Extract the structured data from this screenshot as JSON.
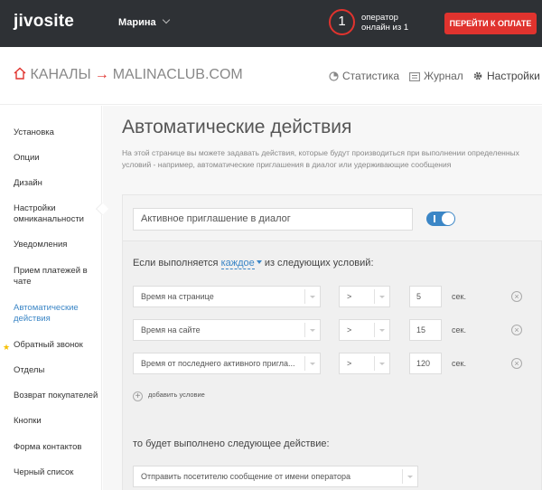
{
  "topbar": {
    "logo": "jivosite",
    "user_name": "Марина",
    "operators_count": "1",
    "operators_text_1": "оператор",
    "operators_text_2": "онлайн из 1",
    "pay_button": "ПЕРЕЙТИ К ОПЛАТЕ",
    "accent_color": "#e0332e"
  },
  "breadcrumb": {
    "root": "КАНАЛЫ",
    "arrow": "→",
    "current": "MALINACLUB.COM"
  },
  "nav": {
    "stats": "Статистика",
    "journal": "Журнал",
    "settings": "Настройки"
  },
  "sidebar": {
    "items": [
      {
        "label": "Установка"
      },
      {
        "label": "Опции"
      },
      {
        "label": "Дизайн"
      },
      {
        "label": "Настройки омниканальности"
      },
      {
        "label": "Уведомления"
      },
      {
        "label": "Прием платежей в чате"
      },
      {
        "label": "Автоматические действия"
      },
      {
        "label": "Обратный звонок"
      },
      {
        "label": "Отделы"
      },
      {
        "label": "Возврат покупателей"
      },
      {
        "label": "Кнопки"
      },
      {
        "label": "Форма контактов"
      },
      {
        "label": "Черный список"
      }
    ],
    "star": "★"
  },
  "main": {
    "title": "Автоматические действия",
    "description": "На этой странице вы можете задавать действия, которые будут производиться при выполнении определенных условий - например, автоматические приглашения в диалог или удерживающие сообщения",
    "rule_name": "Активное приглашение в диалог",
    "toggle_on": true,
    "condition_prefix": "Если выполняется",
    "condition_link": "каждое",
    "condition_suffix": "из следующих условий:",
    "conditions": [
      {
        "field": "Время на странице",
        "operator": ">",
        "value": "5",
        "unit": "сек."
      },
      {
        "field": "Время на сайте",
        "operator": ">",
        "value": "15",
        "unit": "сек."
      },
      {
        "field": "Время от последнего активного пригла...",
        "operator": ">",
        "value": "120",
        "unit": "сек."
      }
    ],
    "add_condition": "добавить условие",
    "action_label": "то будет выполнено следующее действие:",
    "action_select": "Отправить посетителю сообщение от имени оператора",
    "link_color": "#3b86c6"
  }
}
